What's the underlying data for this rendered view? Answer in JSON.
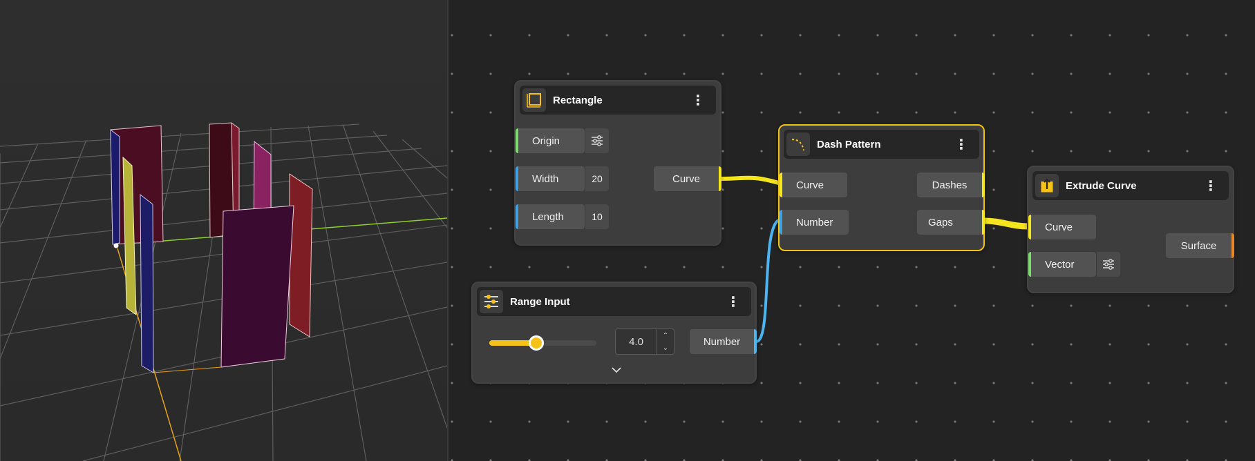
{
  "viewport": {
    "label": "3D viewport"
  },
  "nodes": {
    "rectangle": {
      "title": "Rectangle",
      "icon": "rectangle-icon",
      "inputs": [
        {
          "label": "Origin",
          "value": "",
          "color": "#7ddc6e"
        },
        {
          "label": "Width",
          "value": "20",
          "color": "#3f9fe0"
        },
        {
          "label": "Length",
          "value": "10",
          "color": "#3f9fe0"
        }
      ],
      "output": {
        "label": "Curve",
        "color": "#f5e51e"
      }
    },
    "range_input": {
      "title": "Range Input",
      "icon": "sliders-icon",
      "slider_value": 0.44,
      "value": "4.0",
      "output": {
        "label": "Number",
        "color": "#4cb4f0"
      }
    },
    "dash_pattern": {
      "title": "Dash Pattern",
      "icon": "dashed-curve-icon",
      "inputs": [
        {
          "label": "Curve",
          "color": "#f5e51e"
        },
        {
          "label": "Number",
          "color": "#3f9fe0"
        }
      ],
      "outputs": [
        {
          "label": "Dashes",
          "color": "#f5e51e"
        },
        {
          "label": "Gaps",
          "color": "#f5e51e"
        }
      ]
    },
    "extrude_curve": {
      "title": "Extrude Curve",
      "icon": "extrude-icon",
      "inputs": [
        {
          "label": "Curve",
          "color": "#f5e51e"
        },
        {
          "label": "Vector",
          "color": "#7ddc6e"
        }
      ],
      "output": {
        "label": "Surface",
        "color": "#e8862a"
      }
    }
  },
  "colors": {
    "accent": "#f6c21a",
    "wire_curve": "#f5e51e",
    "wire_number": "#4cb4f0",
    "selection": "#f2c214"
  }
}
